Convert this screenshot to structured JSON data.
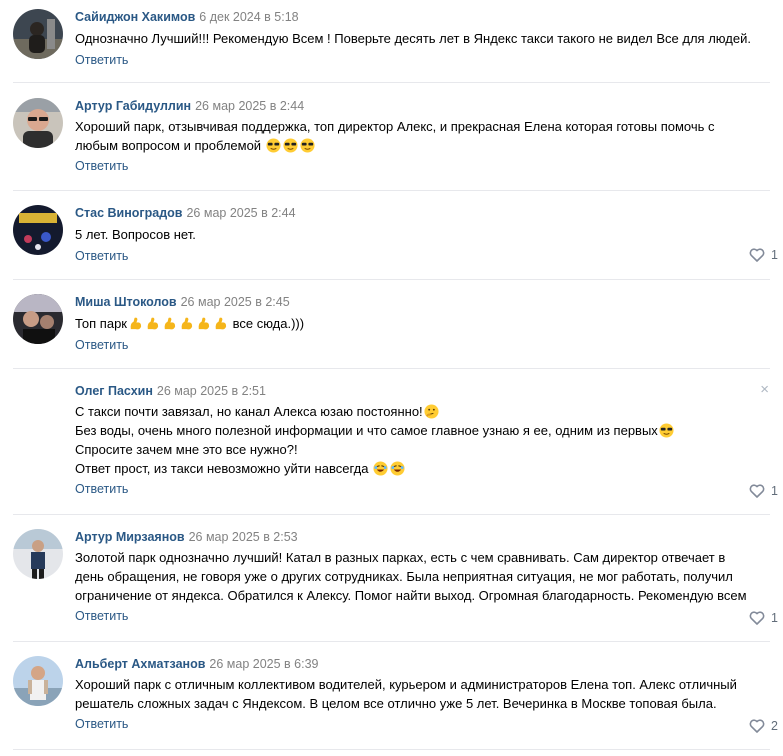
{
  "reply_label": "Ответить",
  "close_glyph": "×",
  "colors": {
    "author": "#2a5885",
    "date": "#828282",
    "separator": "#e7e8ec",
    "icon": "#828a99"
  },
  "comments": [
    {
      "author": "Сайиджон Хакимов",
      "date": "6 дек 2024 в 5:18",
      "lines": [
        "Однозначно Лучший!!! Рекомендую Всем ! Поверьте десять лет в Яндекс такси такого не видел Все для людей."
      ],
      "likes": null
    },
    {
      "author": "Артур Габидуллин",
      "date": "26 мар 2025 в 2:44",
      "lines": [
        "Хороший парк, отзывчивая поддержка, топ директор Алекс, и прекрасная Елена которая готовы помочь с",
        "любым вопросом и проблемой"
      ],
      "emoji": [
        "sunglasses",
        "sunglasses",
        "sunglasses"
      ],
      "likes": null
    },
    {
      "author": "Стас Виноградов",
      "date": "26 мар 2025 в 2:44",
      "lines": [
        "5 лет. Вопросов нет."
      ],
      "likes": "1"
    },
    {
      "author": "Миша Штоколов",
      "date": "26 мар 2025 в 2:45",
      "line_start": "Топ парк",
      "line_end": " все сюда.)))",
      "emoji": [
        "muscle",
        "muscle",
        "muscle",
        "muscle",
        "muscle",
        "muscle"
      ],
      "likes": null
    },
    {
      "author": "Олег Пасхин",
      "date": "26 мар 2025 в 2:51",
      "lines": [
        "С такси почти завязал, но канал Алекса юзаю постоянно!",
        "Без воды, очень много полезной информации и что самое главное узнаю я ее, одним из первых",
        "Спросите зачем мне это все нужно?!",
        "Ответ прост, из такси невозможно уйти навсегда "
      ],
      "emoji": [
        "thinking",
        "sunglasses",
        "rofl",
        "rofl"
      ],
      "likes": "1"
    },
    {
      "author": "Артур Мирзаянов",
      "date": "26 мар 2025 в 2:53",
      "lines": [
        "Золотой парк однозначно лучший! Катал в разных парках, есть с чем сравнивать. Сам директор отвечает в",
        "день обращения, не говоря уже о других сотрудниках. Была неприятная ситуация, не мог работать, получил",
        "ограничение от яндекса. Обратился к Алексу. Помог найти выход. Огромная благодарность. Рекомендую всем"
      ],
      "likes": "1"
    },
    {
      "author": "Альберт Ахматзанов",
      "date": "26 мар 2025 в 6:39",
      "lines": [
        "Хороший парк с отличным коллективом водителей, курьером и администраторов Елена топ. Алекс отличный",
        "решатель сложных задач с Яндексом. В целом все отлично уже 5 лет. Вечеринка в Москве топовая была."
      ],
      "likes": "2"
    }
  ]
}
